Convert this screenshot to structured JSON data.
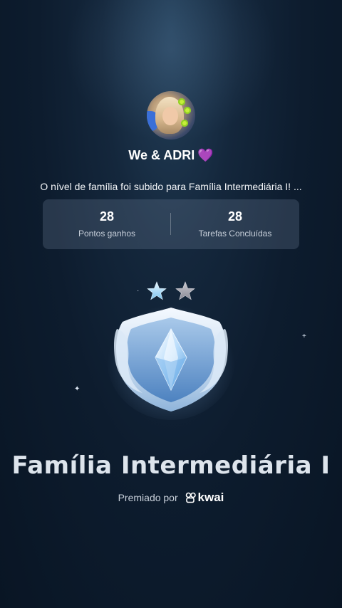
{
  "profile": {
    "name": "We & ADRI",
    "heart": "💜"
  },
  "message": "O nível de família foi subido para Família Intermediária I! ...",
  "stats": {
    "left_value": "28",
    "left_label": "Pontos ganhos",
    "right_value": "28",
    "right_label": "Tarefas Concluídas"
  },
  "badge": {
    "title": "Família Intermediária I",
    "icon": "shield-diamond-icon",
    "stars": [
      "star-filled-icon",
      "star-outline-icon"
    ]
  },
  "award": {
    "prefix": "Premiado por",
    "brand": "kwai"
  },
  "colors": {
    "background": "#0d1c2e",
    "card": "#3a4a5d",
    "accent_heart": "#9a3fe6"
  }
}
